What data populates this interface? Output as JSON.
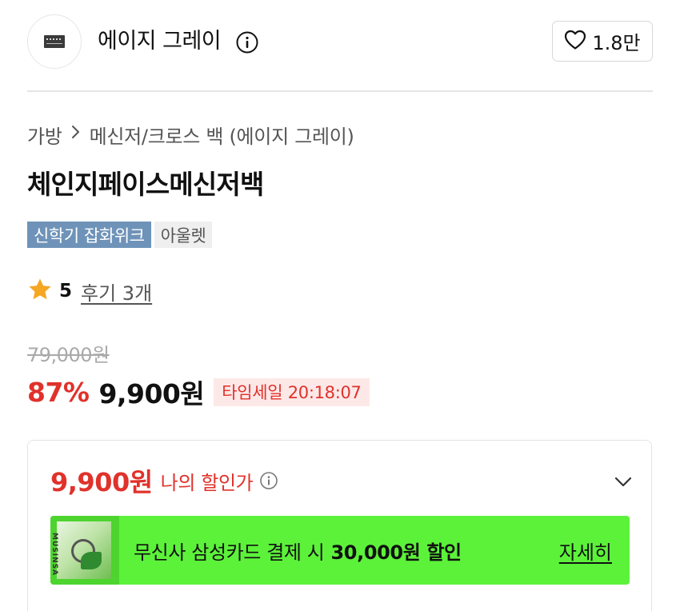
{
  "brand": {
    "name": "에이지 그레이",
    "logo_icon": "brand-logo-icon",
    "like_count": "1.8만"
  },
  "breadcrumb": {
    "category": "가방",
    "separator": ">",
    "subcategory": "메신저/크로스 백 (에이지 그레이)"
  },
  "product": {
    "title": "체인지페이스메신저백",
    "tags": [
      {
        "label": "신학기 잡화위크"
      },
      {
        "label": "아울렛"
      }
    ],
    "rating": {
      "score": "5",
      "review_link": "후기 3개"
    }
  },
  "pricing": {
    "original_price": "79,000원",
    "discount_rate": "87%",
    "sale_price": "9,900원",
    "timesale": "타임세일 20:18:07"
  },
  "my_discount": {
    "price": "9,900원",
    "label": "나의 할인가",
    "banner": {
      "text": "무신사 삼성카드 결제 시",
      "amount": "30,000원 할인",
      "detail_link": "자세히",
      "thumb_text": "MUSINSA"
    }
  },
  "colors": {
    "accent_red": "#e0322b",
    "tag_blue": "#6f93b8",
    "banner_green": "#5cf23a",
    "star": "#f5a623"
  }
}
